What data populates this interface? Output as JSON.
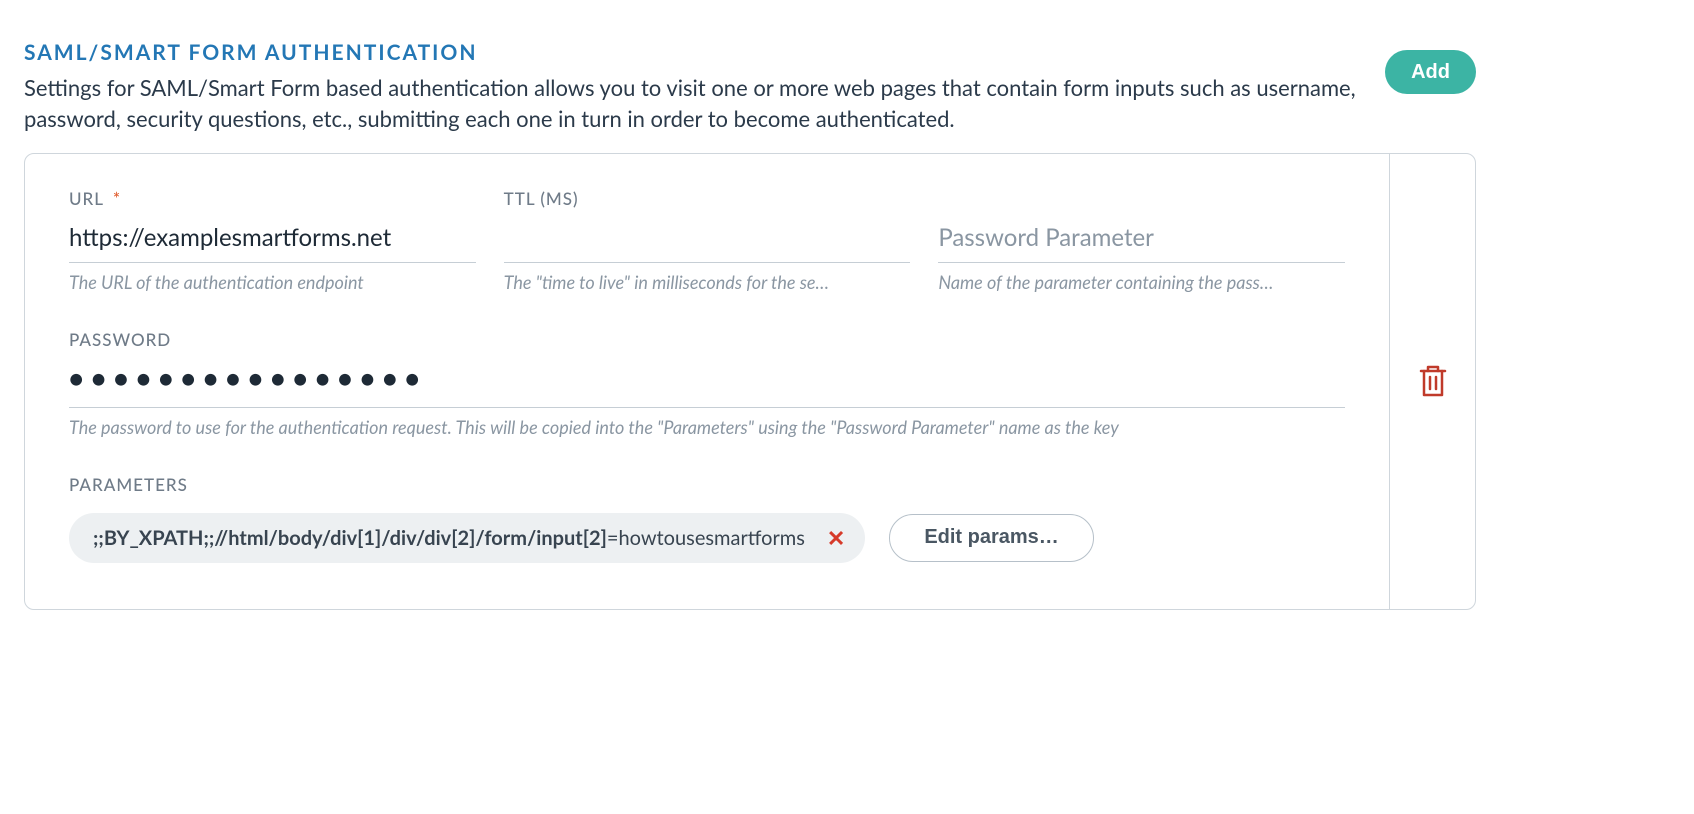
{
  "section": {
    "title": "SAML/SMART FORM AUTHENTICATION",
    "description": "Settings for SAML/Smart Form based authentication allows you to visit one or more web pages that contain form inputs such as username, password, security questions, etc., submitting each one in turn in order to become authenticated.",
    "add_label": "Add"
  },
  "form": {
    "url": {
      "label": "URL",
      "required_mark": "*",
      "value": "https://examplesmartforms.net",
      "hint": "The URL of the authentication endpoint"
    },
    "ttl": {
      "label": "TTL (MS)",
      "value": "",
      "hint": "The \"time to live\" in milliseconds for the se…"
    },
    "password_param": {
      "placeholder": "Password Parameter",
      "value": "",
      "hint": "Name of the parameter containing the pass…"
    },
    "password": {
      "label": "PASSWORD",
      "masked": "●●●●●●●●●●●●●●●●",
      "hint": "The password to use for the authentication request. This will be copied into the \"Parameters\" using the \"Password Parameter\" name as the key"
    },
    "parameters": {
      "label": "PARAMETERS",
      "chip_prefix": ";;BY_XPATH;;//html/body/div[1]/div/div[2]/form/input[2]",
      "chip_sep": "=",
      "chip_value": "howtousesmartforms",
      "remove_glyph": "✕",
      "edit_label": "Edit params…"
    }
  },
  "icons": {
    "trash": "trash"
  }
}
